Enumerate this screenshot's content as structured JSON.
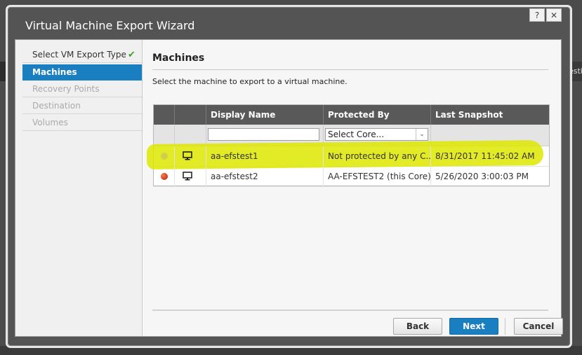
{
  "window": {
    "title": "Virtual Machine Export Wizard",
    "help_label": "?",
    "close_label": "✕"
  },
  "background": {
    "right_fragment": "esti"
  },
  "steps": [
    {
      "label": "Select VM Export Type",
      "state": "done"
    },
    {
      "label": "Machines",
      "state": "active"
    },
    {
      "label": "Recovery Points",
      "state": "disabled"
    },
    {
      "label": "Destination",
      "state": "disabled"
    },
    {
      "label": "Volumes",
      "state": "disabled"
    }
  ],
  "main": {
    "title": "Machines",
    "instruction": "Select the machine to export to a virtual machine."
  },
  "grid": {
    "columns": [
      "Display Name",
      "Protected By",
      "Last Snapshot"
    ],
    "filter": {
      "search_value": "",
      "select_value": "Select Core..."
    },
    "rows": [
      {
        "status": "yellow",
        "icon": "monitor-icon",
        "name": "aa-efstest1",
        "protected_by": "Not protected by any C...",
        "last_snapshot": "8/31/2017 11:45:02 AM"
      },
      {
        "status": "red",
        "icon": "monitor-icon",
        "name": "aa-efstest2",
        "protected_by": "AA-EFSTEST2 (this Core)",
        "last_snapshot": "5/26/2020 3:00:03 PM"
      }
    ]
  },
  "buttons": {
    "back": "Back",
    "next": "Next",
    "cancel": "Cancel"
  },
  "colors": {
    "accent": "#1a7fc1",
    "highlight": "#dee600",
    "header": "#595959"
  }
}
